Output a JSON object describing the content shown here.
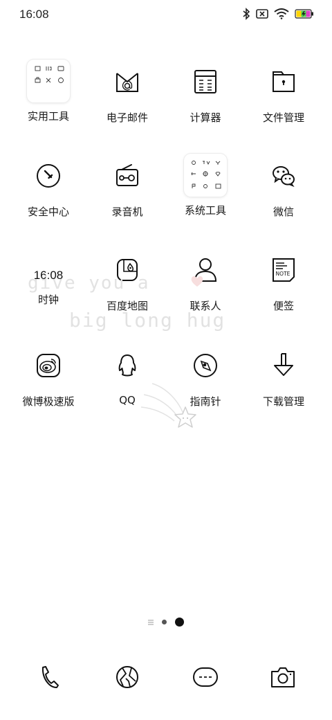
{
  "status_bar": {
    "time": "16:08",
    "icons": [
      "bluetooth-icon",
      "sim-off-icon",
      "wifi-icon",
      "battery-charging-icon"
    ]
  },
  "apps": [
    {
      "label": "实用工具",
      "icon": "folder-utilities-icon"
    },
    {
      "label": "电子邮件",
      "icon": "mail-icon"
    },
    {
      "label": "计算器",
      "icon": "calculator-icon"
    },
    {
      "label": "文件管理",
      "icon": "file-manager-icon"
    },
    {
      "label": "安全中心",
      "icon": "security-icon"
    },
    {
      "label": "录音机",
      "icon": "recorder-icon"
    },
    {
      "label": "系统工具",
      "icon": "folder-system-tools-icon"
    },
    {
      "label": "微信",
      "icon": "wechat-icon"
    },
    {
      "label": "时钟",
      "icon": "clock-widget",
      "clock_text": "16:08"
    },
    {
      "label": "百度地图",
      "icon": "baidu-map-icon"
    },
    {
      "label": "联系人",
      "icon": "contacts-icon"
    },
    {
      "label": "便签",
      "icon": "notes-icon",
      "icon_text": "NOTE"
    },
    {
      "label": "微博极速版",
      "icon": "weibo-icon"
    },
    {
      "label": "QQ",
      "icon": "qq-icon"
    },
    {
      "label": "指南针",
      "icon": "compass-icon"
    },
    {
      "label": "下载管理",
      "icon": "download-icon"
    }
  ],
  "decoration": {
    "line1": "give you a",
    "line2": "big long hug"
  },
  "page_indicator": {
    "pages": 3,
    "current": 3
  },
  "dock": [
    "phone-icon",
    "browser-icon",
    "messages-icon",
    "camera-icon"
  ],
  "colors": {
    "background": "#ffffff",
    "icon_stroke": "#111111",
    "label": "#1a1a1a"
  }
}
